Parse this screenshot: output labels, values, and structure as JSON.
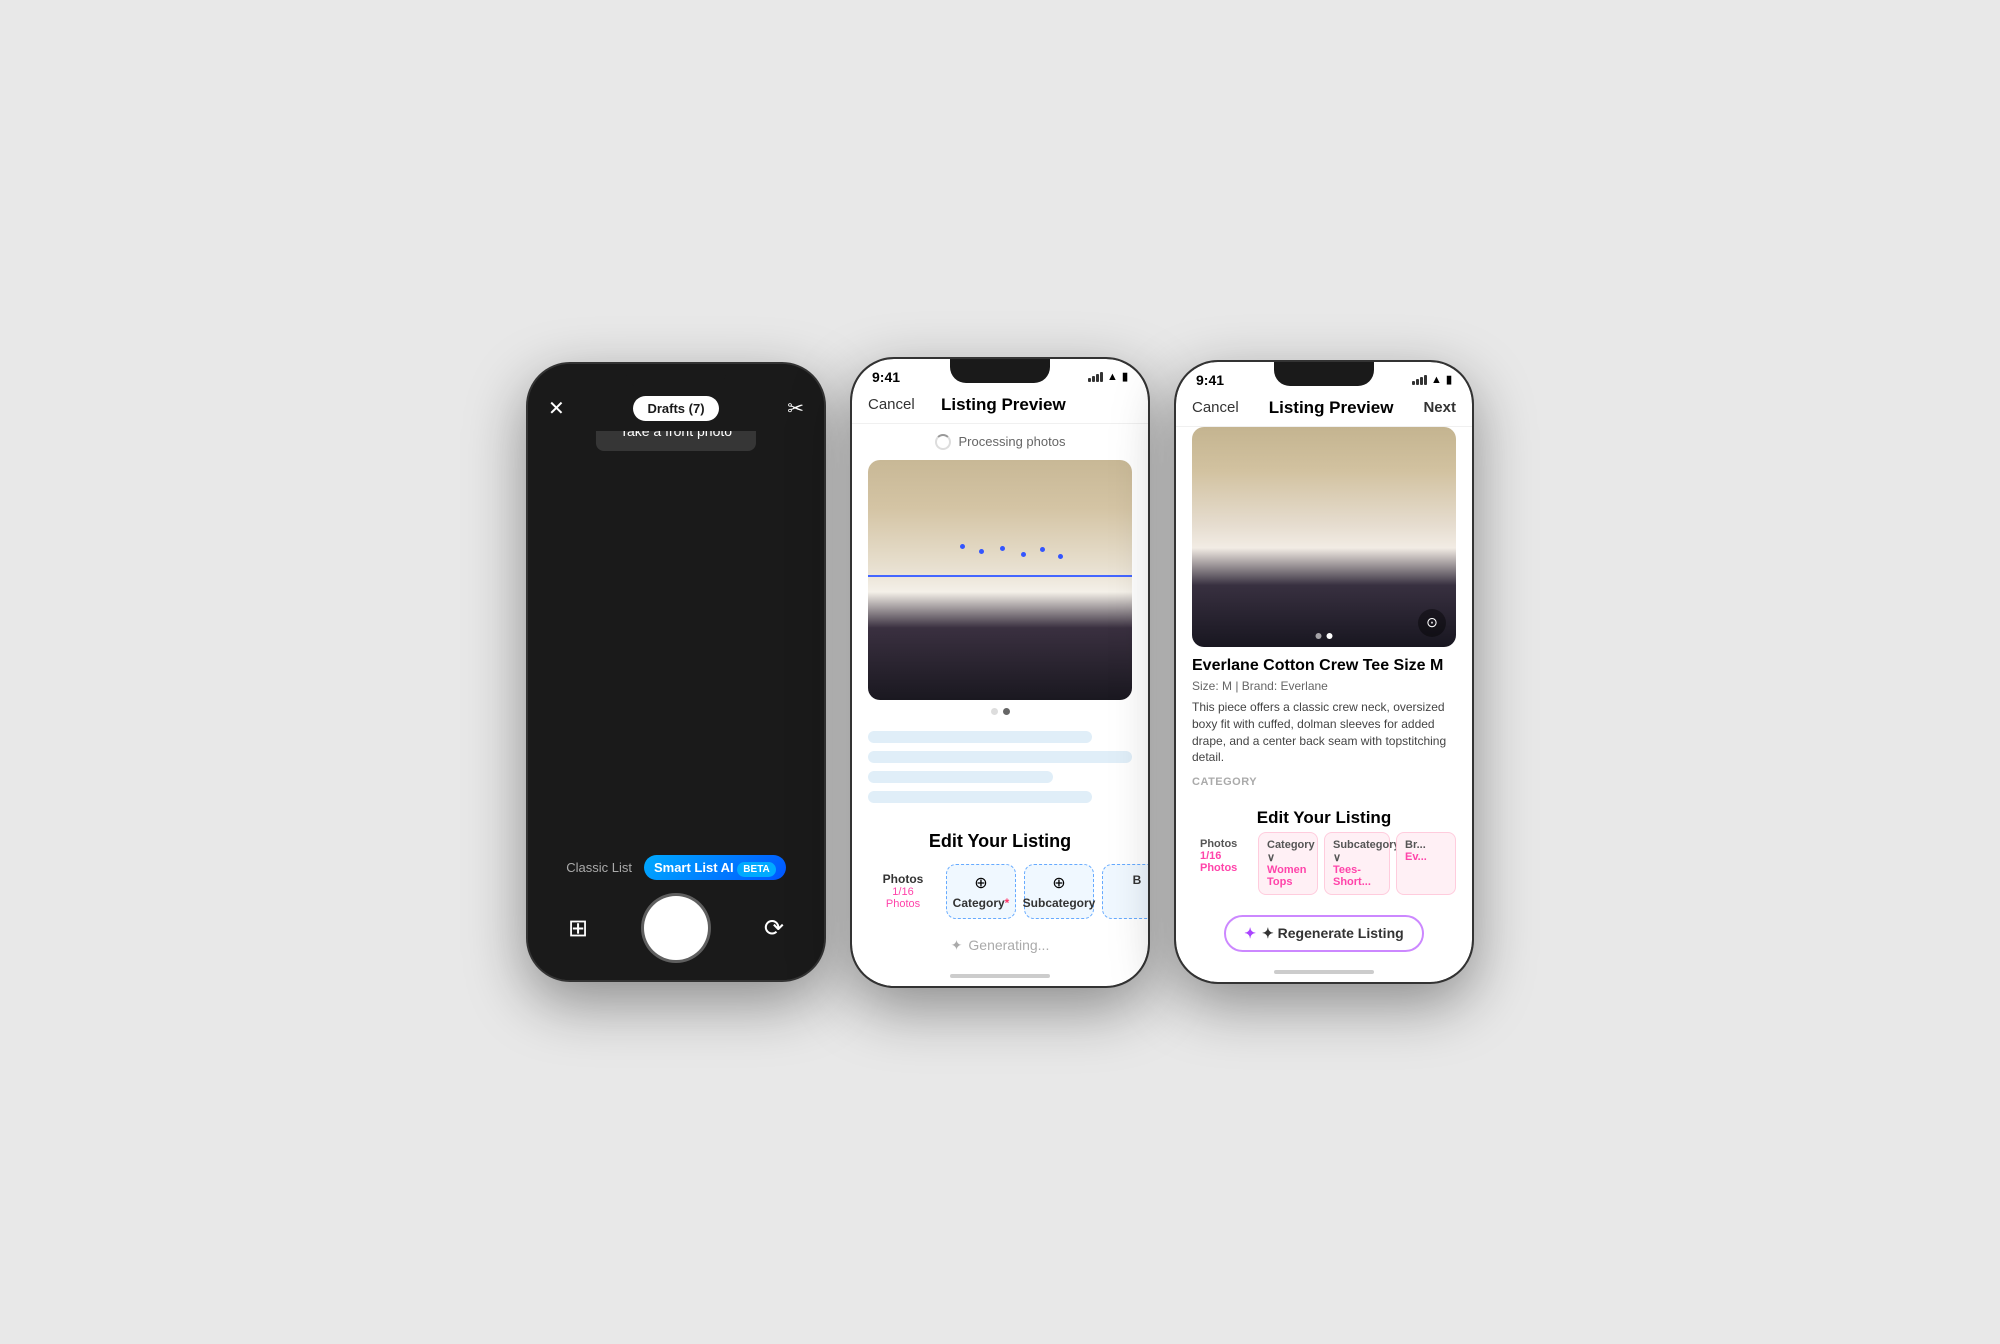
{
  "phone1": {
    "header": {
      "drafts_label": "Drafts (7)"
    },
    "camera": {
      "front_photo_label": "Take a front photo",
      "mode_classic": "Classic List",
      "mode_smart": "Smart List AI",
      "mode_beta": "BETA"
    }
  },
  "phone2": {
    "status": {
      "time": "9:41",
      "signal": "●●●",
      "wifi": "wifi",
      "battery": "battery"
    },
    "header": {
      "cancel": "Cancel",
      "title": "Listing Preview",
      "next": ""
    },
    "processing": {
      "label": "Processing photos"
    },
    "carousel_dots": [
      false,
      true
    ],
    "edit_listing": {
      "title": "Edit Your Listing"
    },
    "tabs": [
      {
        "label": "Photos",
        "sub": "1/16 Photos",
        "icon": "",
        "active": false
      },
      {
        "label": "Category",
        "sub": "",
        "icon": "⊕",
        "active": true,
        "required": true
      },
      {
        "label": "Subcategory",
        "sub": "",
        "icon": "⊕",
        "active": true
      },
      {
        "label": "B",
        "sub": "",
        "icon": "",
        "active": false
      }
    ],
    "generating_label": "Generating..."
  },
  "phone3": {
    "status": {
      "time": "9:41"
    },
    "header": {
      "cancel": "Cancel",
      "title": "Listing Preview",
      "next": "Next"
    },
    "listing": {
      "title": "Everlane Cotton Crew Tee Size M",
      "meta": "Size: M  |  Brand: Everlane",
      "description": "This piece offers a classic crew neck, oversized boxy fit with cuffed, dolman sleeves for added drape, and a center back seam with topstitching detail.",
      "category_label": "CATEGORY"
    },
    "edit_listing": {
      "title": "Edit Your Listing"
    },
    "tabs": [
      {
        "label": "Photos",
        "sub": "1/16 Photos",
        "type": "photos"
      },
      {
        "label": "Category",
        "sub": "Women Tops",
        "type": "active-pink"
      },
      {
        "label": "Subcategory",
        "sub": "Tees- Short...",
        "type": "active-pink"
      },
      {
        "label": "Br...",
        "sub": "Ev...",
        "type": "active-pink"
      }
    ],
    "regen_btn": "✦ Regenerate Listing"
  }
}
